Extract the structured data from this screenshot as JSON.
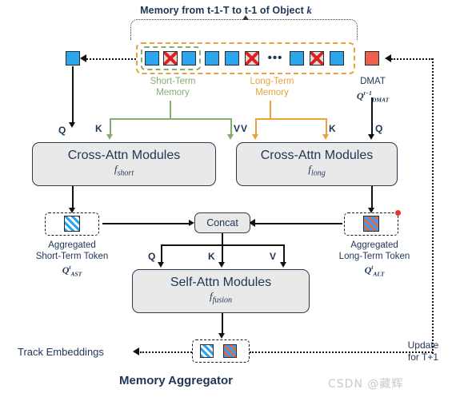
{
  "diagram": {
    "footer_title": "Memory Aggregator",
    "top_title_prefix": "Memory from t-1-T to t-1 of Object ",
    "top_title_italic": "k"
  },
  "memory": {
    "short_term_label_line1": "Short-Term",
    "short_term_label_line2": "Memory",
    "short_term_color": "#83AE6E",
    "long_term_label_line1": "Long-Term",
    "long_term_label_line2": "Memory",
    "long_term_color": "#E8A33D",
    "ellipsis": "•••",
    "tokens_short": [
      "alive",
      "dead",
      "alive"
    ],
    "tokens_long": [
      "alive",
      "alive",
      "dead",
      "ellipsis",
      "alive",
      "dead",
      "alive"
    ],
    "left_token": "alive",
    "token_alive_color": "#2BA5EE",
    "token_cross_color": "#E02020",
    "dmat_color": "#EE5F4E"
  },
  "dmat": {
    "label": "DMAT",
    "symbol_base": "Q",
    "symbol_sup": "t−1",
    "symbol_sub": "DMAT"
  },
  "qkv": {
    "short_q": "Q",
    "short_k": "K",
    "short_v": "V",
    "long_v": "V",
    "long_k": "K",
    "long_q": "Q",
    "fusion_q": "Q",
    "fusion_k": "K",
    "fusion_v": "V"
  },
  "modules": {
    "cross_short": {
      "title": "Cross-Attn Modules",
      "subtitle_base": "f",
      "subtitle_sub": "short"
    },
    "cross_long": {
      "title": "Cross-Attn Modules",
      "subtitle_base": "f",
      "subtitle_sub": "long"
    },
    "self_fusion": {
      "title": "Self-Attn Modules",
      "subtitle_base": "f",
      "subtitle_sub": "fusion"
    },
    "concat": {
      "label": "Concat"
    }
  },
  "aggregated": {
    "short": {
      "line1": "Aggregated",
      "line2": "Short-Term Token",
      "symbol_base": "Q",
      "symbol_sup": "t",
      "symbol_sub": "AST"
    },
    "long": {
      "line1": "Aggregated",
      "line2": "Long-Term Token",
      "symbol_base": "Q",
      "symbol_sup": "t",
      "symbol_sub": "ALT"
    }
  },
  "output": {
    "track_embeddings": "Track Embeddings",
    "update_line1": "Update",
    "update_line2": "for T+1"
  },
  "watermark": {
    "text": "CSDN @藏辉"
  }
}
